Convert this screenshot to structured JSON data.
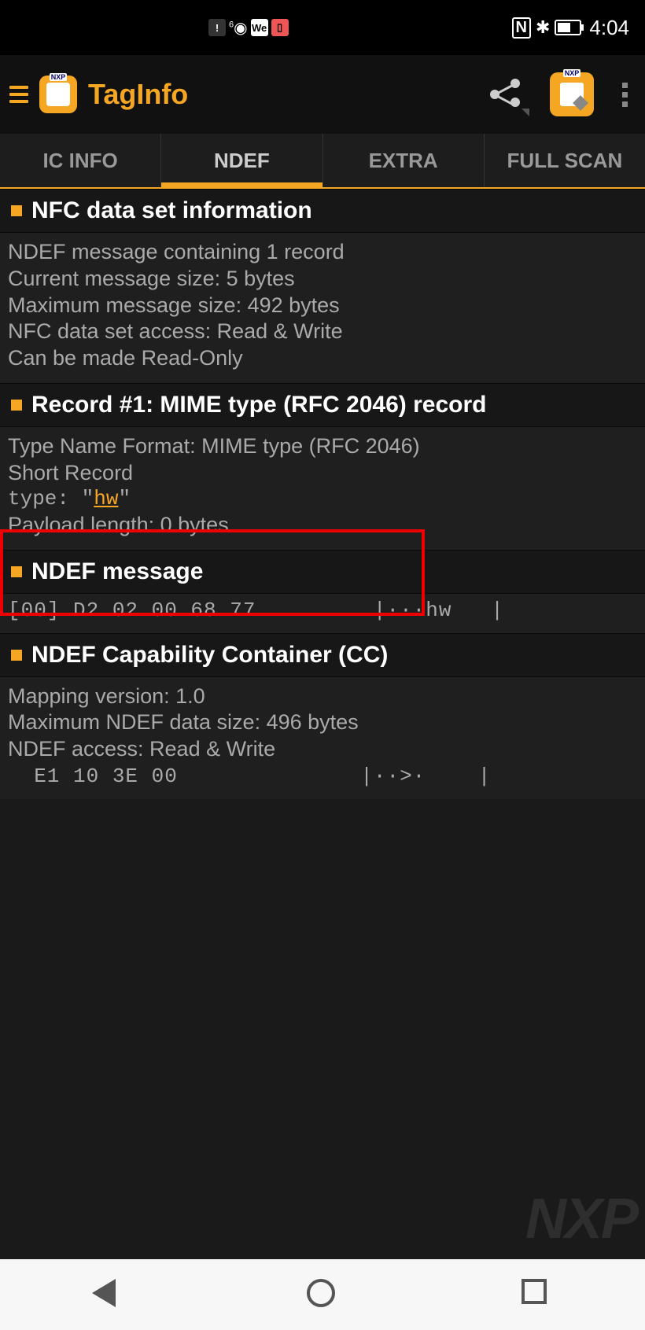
{
  "status": {
    "time": "4:04",
    "icon_alert": "!",
    "icon_wifi_badge": "6",
    "icon_we": "We",
    "icon_nfc": "N",
    "icon_bt": "✱"
  },
  "header": {
    "app_title": "TagInfo"
  },
  "tabs": [
    {
      "label": "IC INFO",
      "active": false
    },
    {
      "label": "NDEF",
      "active": true
    },
    {
      "label": "EXTRA",
      "active": false
    },
    {
      "label": "FULL SCAN",
      "active": false
    }
  ],
  "sections": {
    "nfc_info": {
      "title": "NFC data set information",
      "lines": [
        "NDEF message containing 1 record",
        "Current message size: 5 bytes",
        "Maximum message size: 492 bytes",
        "NFC data set access: Read & Write",
        "Can be made Read-Only"
      ]
    },
    "record1": {
      "title": "Record #1: MIME type (RFC 2046) record",
      "line1": "Type Name Format: MIME type (RFC 2046)",
      "line2": "Short Record",
      "type_label": "type: \"",
      "type_value": "hw",
      "type_close": "\"",
      "line4": "Payload length: 0 bytes"
    },
    "ndef_msg": {
      "title": "NDEF message",
      "hex": "[00] D2 02 00 68 77         |···hw   |"
    },
    "cc": {
      "title": "NDEF Capability Container (CC)",
      "line1": "Mapping version: 1.0",
      "line2": "Maximum NDEF data size: 496 bytes",
      "line3": "NDEF access: Read & Write",
      "hex": "  E1 10 3E 00              |··>·    |"
    }
  },
  "watermark": "NXP"
}
